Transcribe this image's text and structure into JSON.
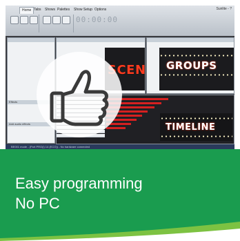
{
  "screenshot": {
    "app_tabs": [
      "Home",
      "Tabs",
      "Shows",
      "Palettes",
      "Show Setup",
      "Options"
    ],
    "time_display": "00:00:00",
    "window_title": "Sunlite - ?",
    "panels": {
      "scenes": "SCENES",
      "groups": "GROUPS",
      "timeline": "TIMELINE",
      "effects_header": "Effects",
      "add_effects_header": "Add audio effects"
    },
    "status_text": "BE001 mode - (Port PRO(i) 14 (ECO)) - No hardware connected"
  },
  "caption": {
    "line1": "Easy programming",
    "line2": "No PC"
  },
  "colors": {
    "green_band": "#1a9c4f",
    "accent_red": "#d62020"
  },
  "icons": {
    "thumb": "thumbs-up-icon"
  }
}
